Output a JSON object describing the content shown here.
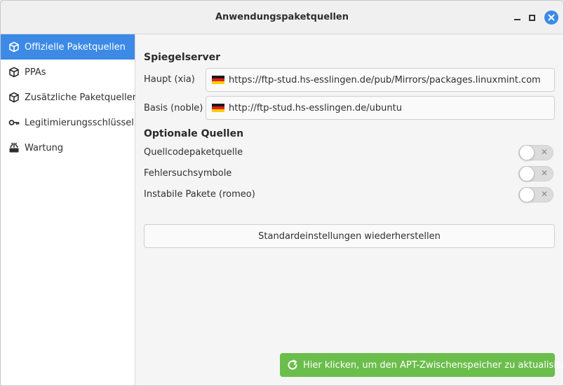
{
  "window": {
    "title": "Anwendungspaketquellen"
  },
  "sidebar": {
    "items": [
      {
        "label": "Offizielle Paketquellen",
        "icon": "package-icon",
        "active": true
      },
      {
        "label": "PPAs",
        "icon": "package-icon",
        "active": false
      },
      {
        "label": "Zusätzliche Paketquellen",
        "icon": "package-icon",
        "active": false
      },
      {
        "label": "Legitimierungsschlüssel",
        "icon": "key-icon",
        "active": false
      },
      {
        "label": "Wartung",
        "icon": "maintenance-icon",
        "active": false
      }
    ]
  },
  "mirrors": {
    "section_title": "Spiegelserver",
    "main_label": "Haupt (xia)",
    "main_url": "https://ftp-stud.hs-esslingen.de/pub/Mirrors/packages.linuxmint.com",
    "base_label": "Basis (noble)",
    "base_url": "http://ftp-stud.hs-esslingen.de/ubuntu",
    "flag": "germany-flag-icon"
  },
  "optional": {
    "section_title": "Optionale Quellen",
    "items": [
      {
        "label": "Quellcodepaketquelle",
        "enabled": false
      },
      {
        "label": "Fehlersuchsymbole",
        "enabled": false
      },
      {
        "label": "Instabile Pakete (romeo)",
        "enabled": false
      }
    ]
  },
  "actions": {
    "reset_label": "Standardeinstellungen wiederherstellen",
    "update_label": "Hier klicken, um den APT-Zwischenspeicher zu aktualisieren"
  },
  "colors": {
    "accent": "#3c8ae5",
    "update_button": "#6bbe4b"
  }
}
